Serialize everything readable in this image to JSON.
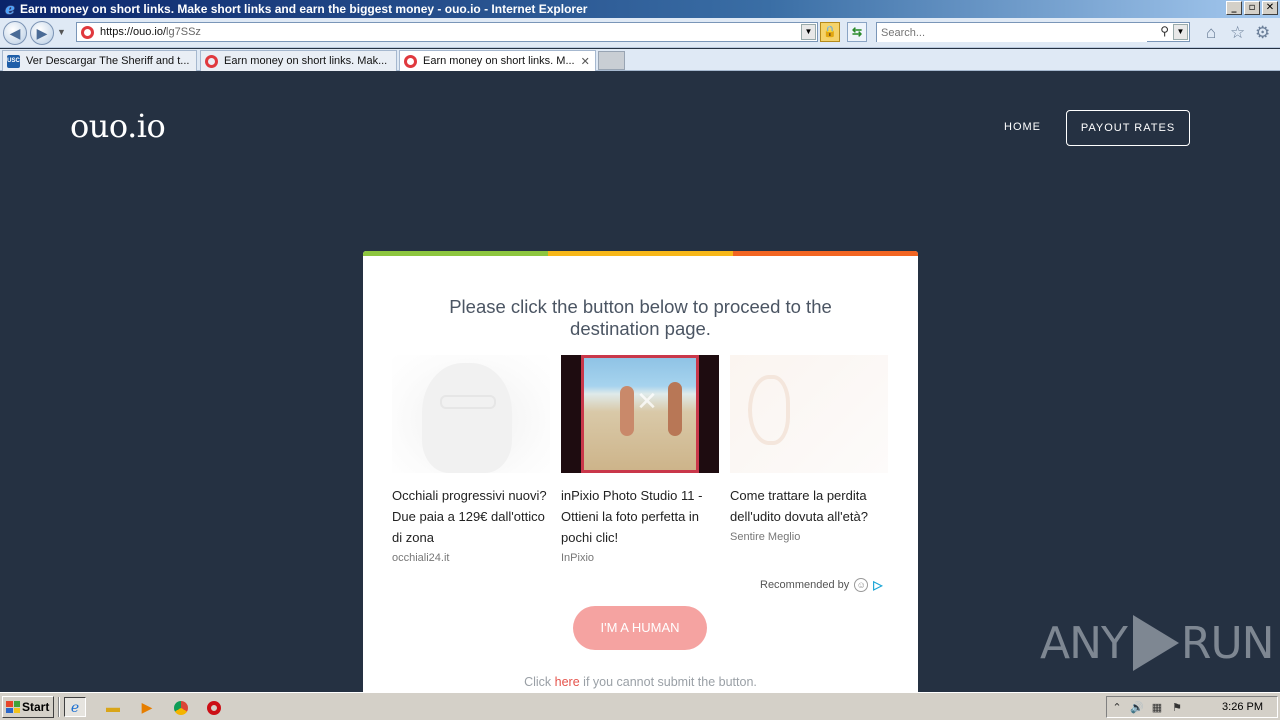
{
  "window": {
    "title": "Earn money on short links. Make short links and earn the biggest money - ouo.io - Internet Explorer",
    "buttons": {
      "minimize": "_",
      "maximize": "▫",
      "close": "✕"
    }
  },
  "browser": {
    "url_host": "https://ouo.io/",
    "url_path": "lg7SSz",
    "search_placeholder": "Search...",
    "tabs": [
      {
        "label": "Ver Descargar The Sheriff and t...",
        "icon": "usc",
        "active": false
      },
      {
        "label": "Earn money on short links. Mak...",
        "icon": "ouo",
        "active": false
      },
      {
        "label": "Earn money on short links. M...",
        "icon": "ouo",
        "active": true
      }
    ]
  },
  "site": {
    "logo": "ouo.io",
    "nav": {
      "home": "HOME",
      "payout": "PAYOUT RATES"
    }
  },
  "card": {
    "stripe_colors": [
      "#8dc63f",
      "#f7b718",
      "#f26522"
    ],
    "heading": "Please click the button below to proceed to the destination page.",
    "recommendations": [
      {
        "title": "Occhiali progressivi nuovi? Due paia a 129€ dall'ottico di zona",
        "source": "occhiali24.it"
      },
      {
        "title": "inPixio Photo Studio 11 - Ottieni la foto perfetta in pochi clic!",
        "source": "InPixio"
      },
      {
        "title": "Come trattare la perdita dell'udito dovuta all'età?",
        "source": "Sentire Meglio"
      }
    ],
    "recommended_by": "Recommended by",
    "human_button": "I'M A HUMAN",
    "help_prefix": "Click ",
    "help_link": "here",
    "help_suffix": " if you cannot submit the button.",
    "button_color": "#f5a3a1"
  },
  "watermark": {
    "left": "ANY",
    "right": "RUN"
  },
  "taskbar": {
    "start": "Start",
    "clock": "3:26 PM"
  },
  "colors": {
    "page_bg": "#253142",
    "accent": "#e5534b"
  }
}
